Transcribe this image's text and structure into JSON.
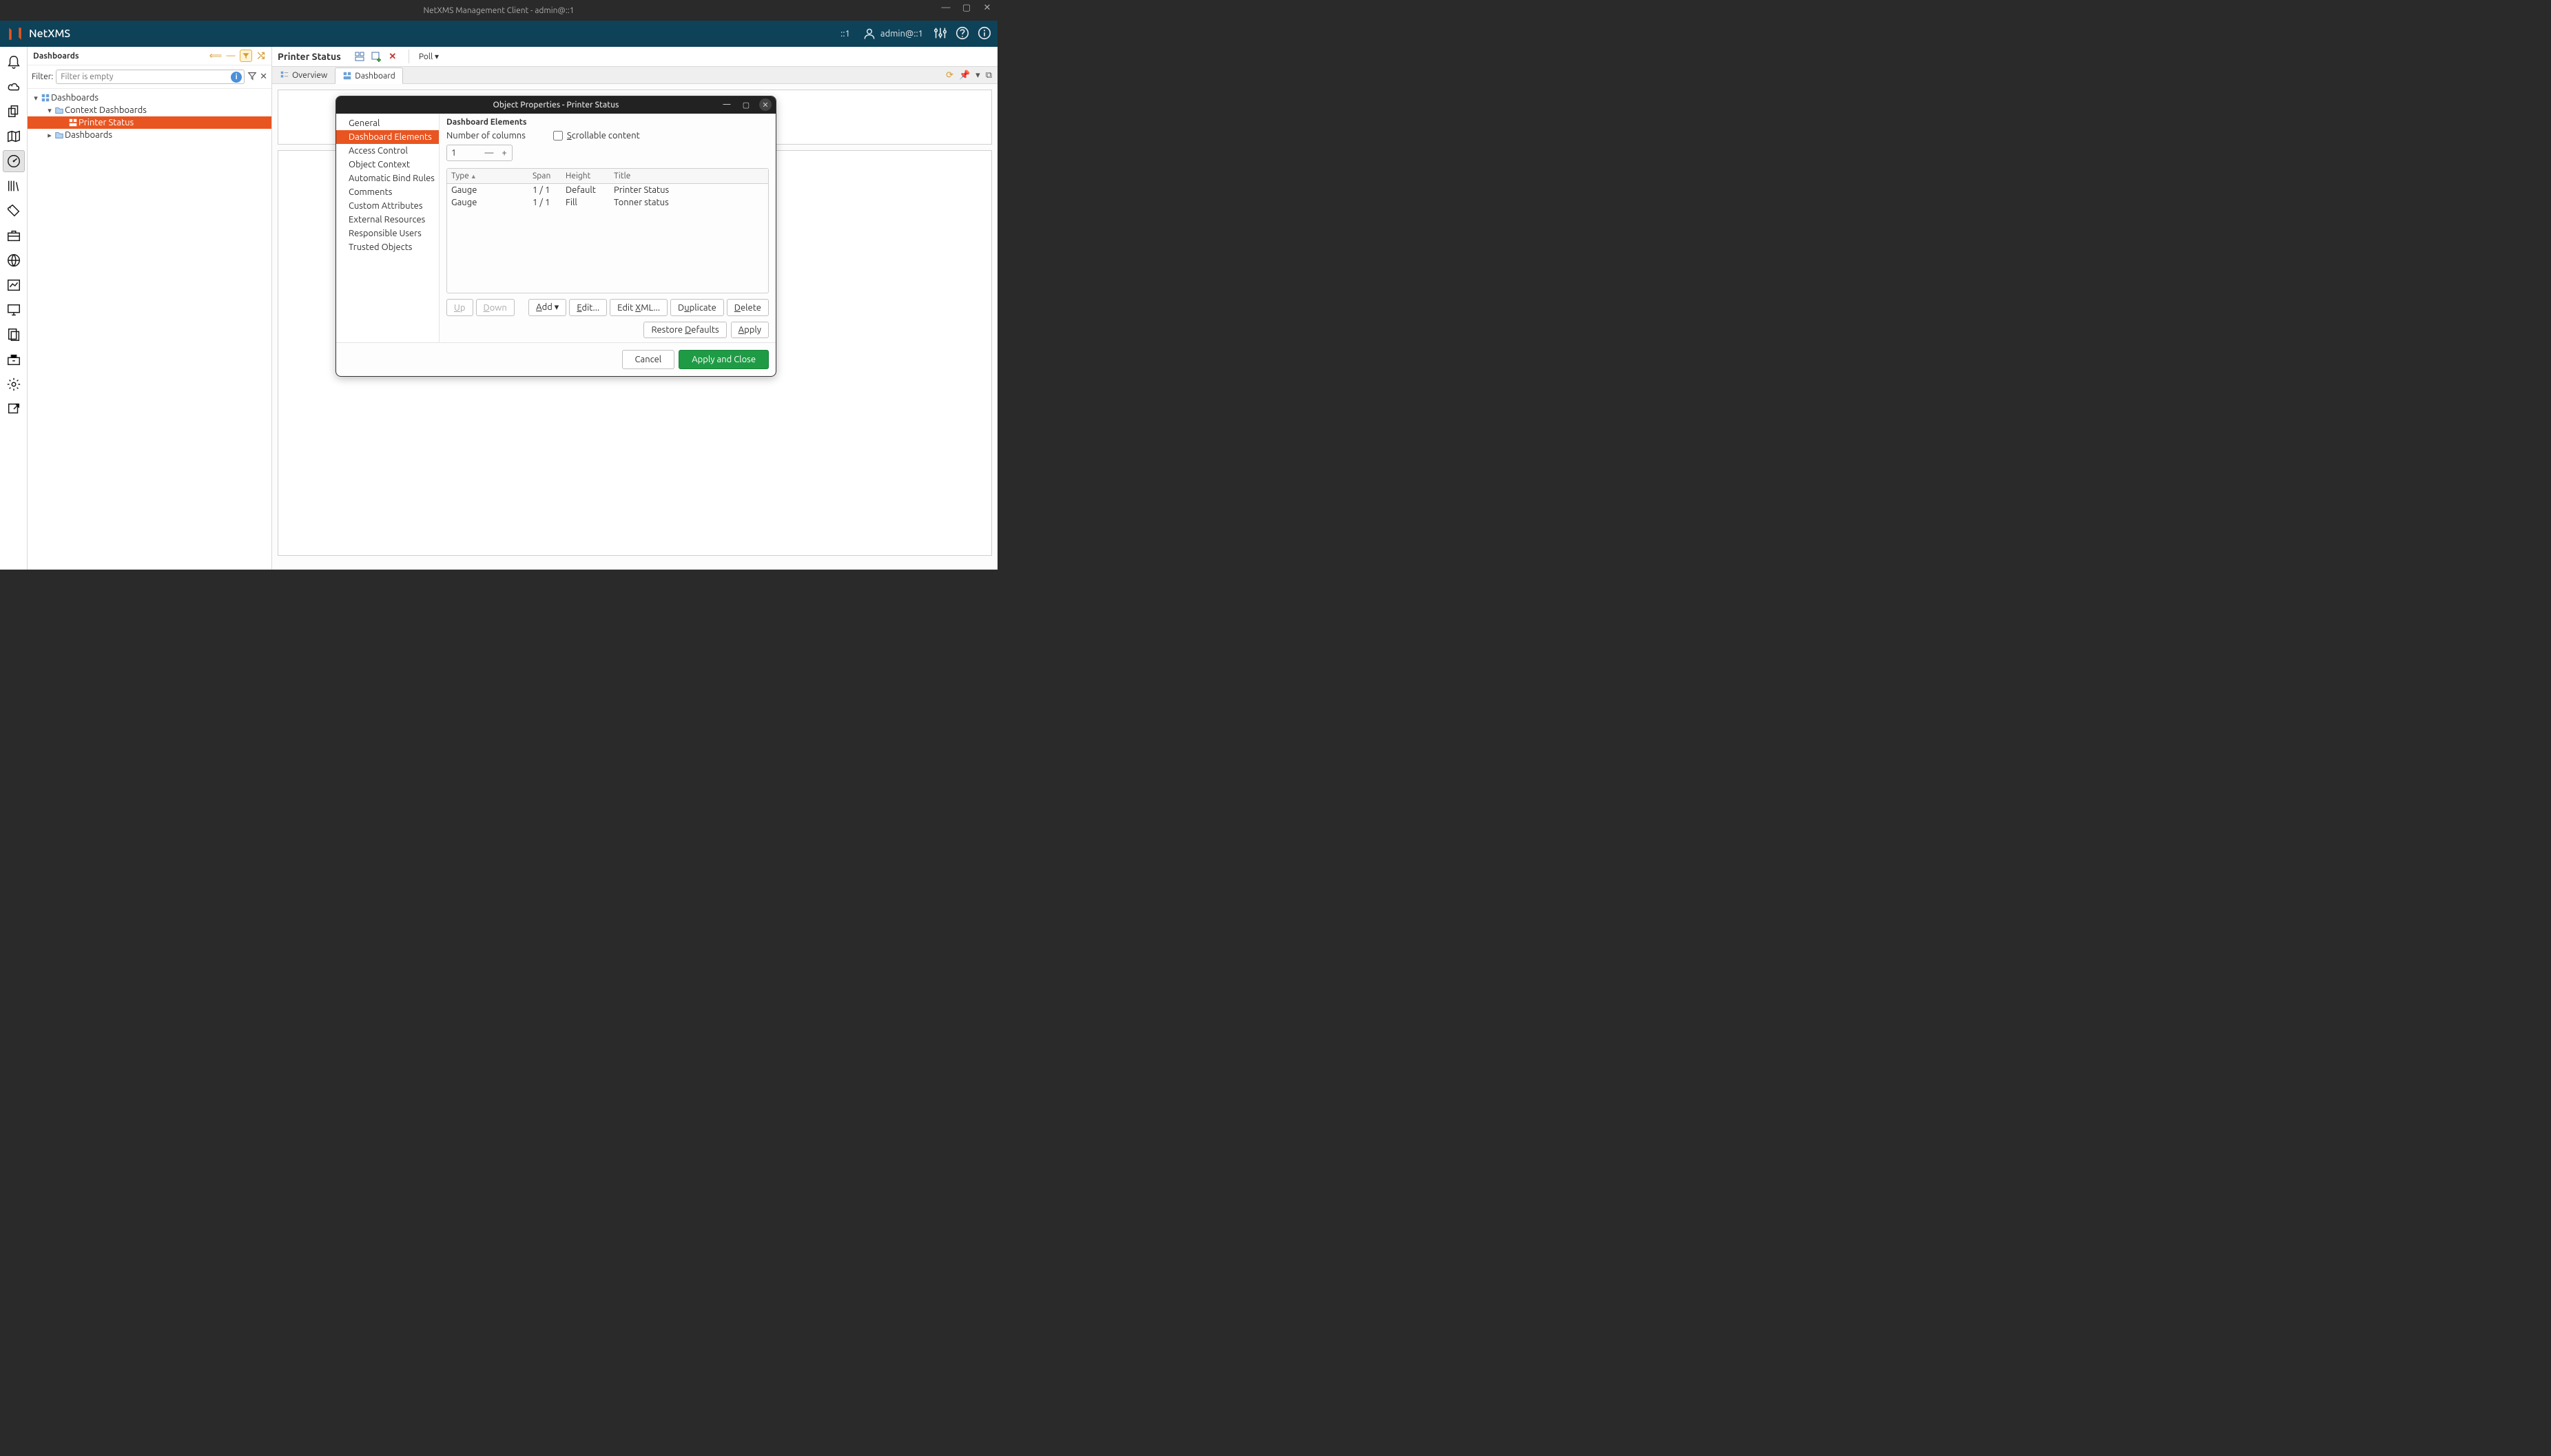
{
  "titlebar": {
    "title": "NetXMS Management Client - admin@::1"
  },
  "appbar": {
    "product": "NetXMS",
    "server": "::1",
    "user": "admin@::1"
  },
  "dashboards_panel": {
    "header": "Dashboards",
    "filter_label": "Filter:",
    "filter_placeholder": "Filter is empty",
    "tree": {
      "root": "Dashboards",
      "ctx": "Context Dashboards",
      "sel": "Printer Status",
      "dashboards": "Dashboards"
    }
  },
  "editor": {
    "title": "Printer Status",
    "poll_label": "Poll ▾",
    "tabs": {
      "overview": "Overview",
      "dashboard": "Dashboard"
    }
  },
  "dialog": {
    "title": "Object Properties - Printer Status",
    "nav": [
      "General",
      "Dashboard Elements",
      "Access Control",
      "Object Context",
      "Automatic Bind Rules",
      "Comments",
      "Custom Attributes",
      "External Resources",
      "Responsible Users",
      "Trusted Objects"
    ],
    "nav_selected_index": 1,
    "content_title": "Dashboard Elements",
    "num_columns_label": "Number of columns",
    "num_columns_value": "1",
    "scrollable_label": "Scrollable content",
    "scrollable_accel": "S",
    "table": {
      "headers": {
        "type": "Type",
        "span": "Span",
        "height": "Height",
        "title": "Title"
      },
      "rows": [
        {
          "type": "Gauge",
          "span": "1 / 1",
          "height": "Default",
          "title": "Printer Status"
        },
        {
          "type": "Gauge",
          "span": "1 / 1",
          "height": "Fill",
          "title": "Tonner status"
        }
      ]
    },
    "buttons": {
      "up": "Up",
      "down": "Down",
      "add": "Add ▾",
      "edit": "Edit...",
      "editxml": "Edit XML...",
      "duplicate": "Duplicate",
      "delete": "Delete",
      "restore": "Restore Defaults",
      "apply": "Apply",
      "cancel": "Cancel",
      "apply_close": "Apply and Close",
      "accel": {
        "up": "U",
        "down": "D",
        "add": "A",
        "edit": "E",
        "editxml": "X",
        "duplicate": "u",
        "delete": "D",
        "restore": "D",
        "apply": "A"
      }
    }
  }
}
